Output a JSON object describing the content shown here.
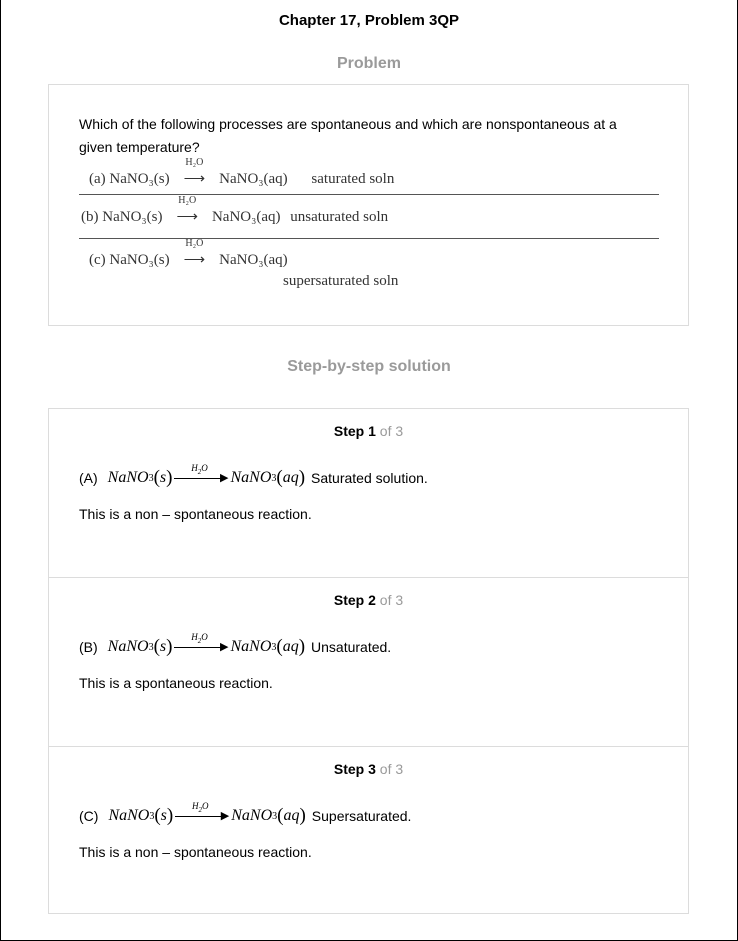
{
  "title": "Chapter 17, Problem 3QP",
  "problem": {
    "heading": "Problem",
    "question": "Which of the following processes are spontaneous and which are nonspontaneous at a given temperature?",
    "reactions": [
      {
        "label": "(a)",
        "reactant": "NaNO₃(s)",
        "over_arrow": "H₂O",
        "product": "NaNO₃(aq)",
        "note": "saturated soln"
      },
      {
        "label": "(b)",
        "reactant": "NaNO₃(s)",
        "over_arrow": "H₂O",
        "product": "NaNO₃(aq)",
        "note": "unsaturated soln"
      },
      {
        "label": "(c)",
        "reactant": "NaNO₃(s)",
        "over_arrow": "H₂O",
        "product": "NaNO₃(aq)",
        "note": "supersaturated soln"
      }
    ]
  },
  "solution": {
    "heading": "Step-by-step solution",
    "step_word": "Step",
    "of_total": "of 3",
    "steps": [
      {
        "number": "1",
        "label": "(A)",
        "description": "Saturated solution.",
        "conclusion": "This is a non – spontaneous reaction."
      },
      {
        "number": "2",
        "label": "(B)",
        "description": "Unsaturated.",
        "conclusion": "This is a spontaneous reaction."
      },
      {
        "number": "3",
        "label": "(C)",
        "description": "Supersaturated.",
        "conclusion": "This is a non – spontaneous reaction."
      }
    ]
  }
}
